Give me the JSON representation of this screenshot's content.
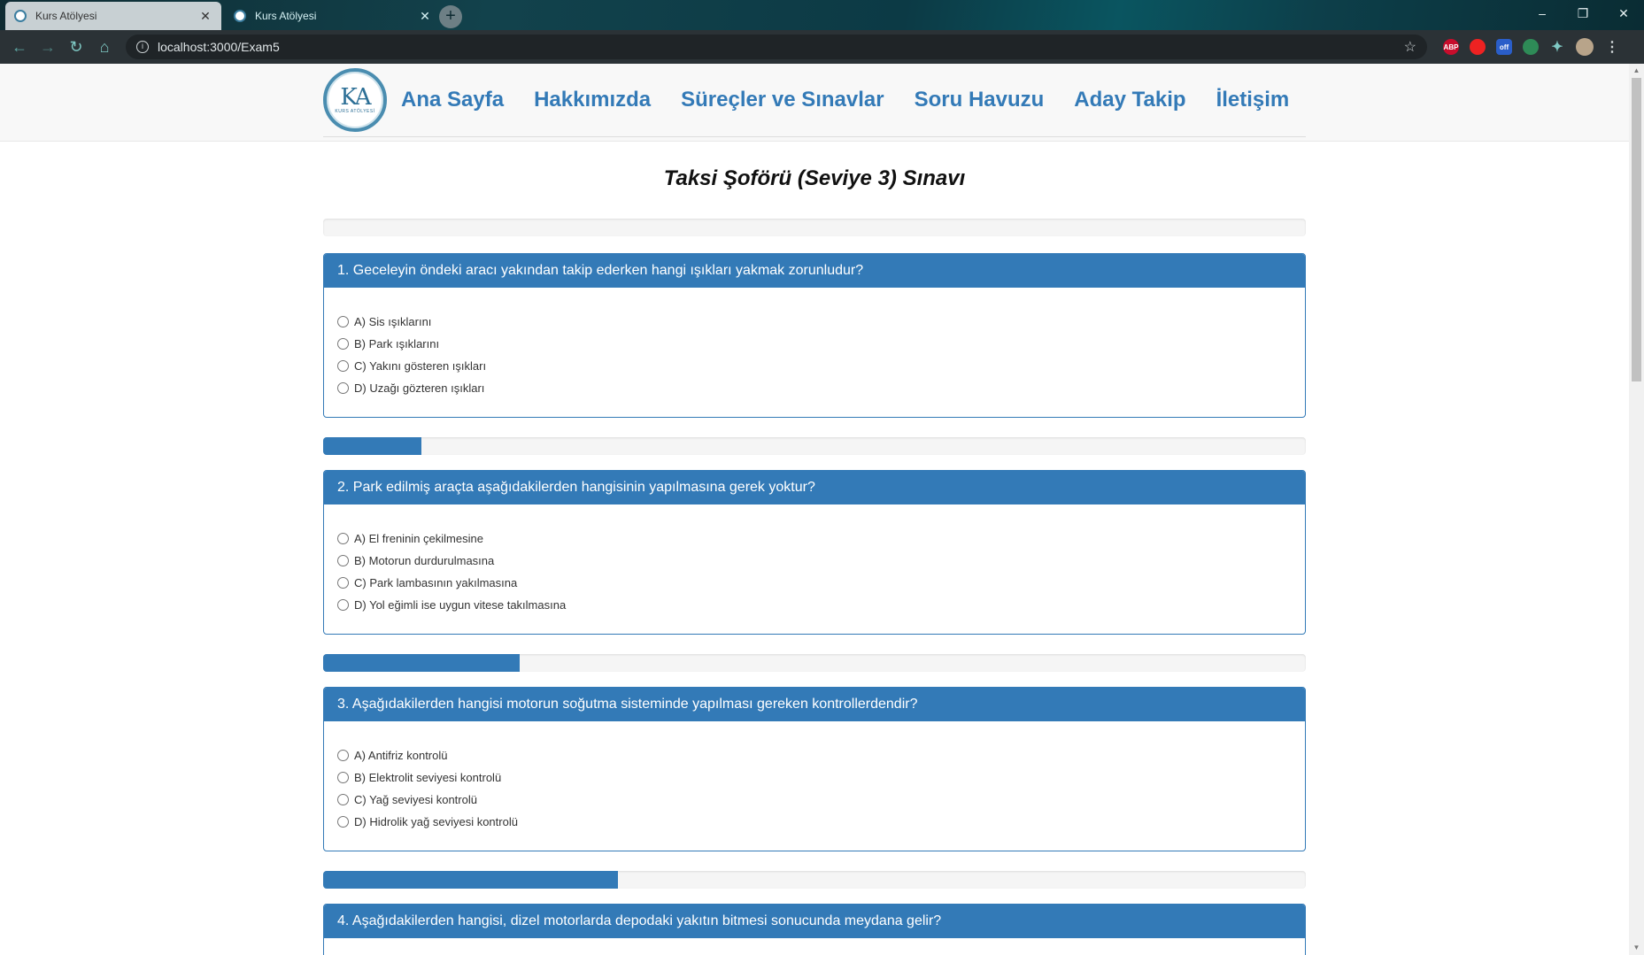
{
  "browser": {
    "tabs": [
      {
        "title": "Kurs Atölyesi",
        "active": false
      },
      {
        "title": "Kurs Atölyesi",
        "active": true
      }
    ],
    "url": "localhost:3000/Exam5",
    "window_controls": {
      "minimize": "–",
      "restore": "❐",
      "close": "✕"
    },
    "extensions": [
      "ABP",
      "",
      "off",
      "",
      "",
      "",
      ""
    ]
  },
  "site": {
    "logo": {
      "mark": "KA",
      "sub": "KURS ATÖLYESİ"
    },
    "nav": [
      "Ana Sayfa",
      "Hakkımızda",
      "Süreçler ve Sınavlar",
      "Soru Havuzu",
      "Aday Takip",
      "İletişim"
    ]
  },
  "exam": {
    "title": "Taksi Şoförü (Seviye 3) Sınavı",
    "progress": [
      0,
      0.1,
      0.2,
      0.3
    ],
    "questions": [
      {
        "text": "1. Geceleyin öndeki aracı yakından takip ederken hangi ışıkları yakmak zorunludur?",
        "options": [
          "A) Sis ışıklarını",
          "B) Park ışıklarını",
          "C) Yakını gösteren ışıkları",
          "D) Uzağı gözteren ışıkları"
        ]
      },
      {
        "text": "2. Park edilmiş araçta aşağıdakilerden hangisinin yapılmasına gerek yoktur?",
        "options": [
          "A) El freninin çekilmesine",
          "B) Motorun durdurulmasına",
          "C) Park lambasının yakılmasına",
          "D) Yol eğimli ise uygun vitese takılmasına"
        ]
      },
      {
        "text": "3. Aşağıdakilerden hangisi motorun soğutma sisteminde yapılması gereken kontrollerdendir?",
        "options": [
          "A) Antifriz kontrolü",
          "B) Elektrolit seviyesi kontrolü",
          "C) Yağ seviyesi kontrolü",
          "D) Hidrolik yağ seviyesi kontrolü"
        ]
      },
      {
        "text": "4. Aşağıdakilerden hangisi, dizel motorlarda depodaki yakıtın bitmesi sonucunda meydana gelir?",
        "options": []
      }
    ]
  },
  "colors": {
    "primary": "#337ab7",
    "progress_track": "#f5f5f5",
    "chrome_dark": "#2b3236"
  }
}
